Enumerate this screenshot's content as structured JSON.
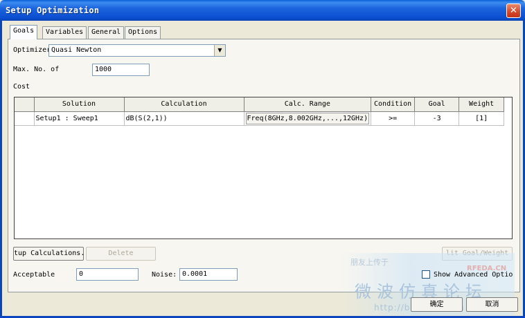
{
  "window": {
    "title": "Setup Optimization",
    "close_glyph": "✕"
  },
  "tabs": [
    "Goals",
    "Variables",
    "General",
    "Options"
  ],
  "goals": {
    "optimizer_label": "Optimizer",
    "optimizer_value": "Quasi Newton",
    "max_label": "Max. No. of",
    "max_value": "1000",
    "cost_label": "Cost",
    "columns": [
      "",
      "Solution",
      "Calculation",
      "Calc. Range",
      "Condition",
      "Goal",
      "Weight"
    ],
    "rows": [
      {
        "solution": "Setup1 : Sweep1",
        "calculation": "dB(S(2,1))",
        "range": "Freq(8GHz,8.002GHz,...,12GHz)",
        "condition": ">=",
        "goal": "-3",
        "weight": "[1]"
      }
    ],
    "setup_calc_button": "tup Calculations.",
    "delete_button": "Delete",
    "edit_goal_button": "lit Goal/Weight",
    "acceptable_label": "Acceptable",
    "acceptable_value": "0",
    "noise_label": "Noise:",
    "noise_value": "0.0001",
    "advanced_label": "Show Advanced Optio"
  },
  "footer": {
    "ok": "确定",
    "cancel": "取消"
  },
  "watermark": {
    "line1": "朋友上传于",
    "line2": "微波仿真论坛",
    "line3": "http://bbs.rfeda.cn",
    "logo": "RFEDA.CN"
  }
}
